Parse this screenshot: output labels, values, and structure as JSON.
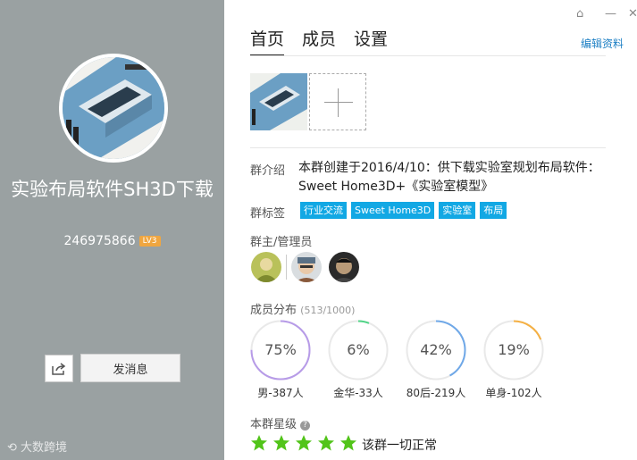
{
  "group": {
    "name": "实验布局软件SH3D下载",
    "id": "246975866",
    "level": "LV3"
  },
  "buttons": {
    "send_message": "发消息"
  },
  "watermark": "大数跨境",
  "window": {
    "controls": [
      "⌂",
      "—",
      "✕"
    ]
  },
  "tabs": [
    {
      "label": "首页",
      "active": true
    },
    {
      "label": "成员",
      "active": false
    },
    {
      "label": "设置",
      "active": false
    }
  ],
  "edit_link": "编辑资料",
  "intro": {
    "label": "群介绍",
    "text": "本群创建于2016/4/10：供下载实验室规划布局软件：  Sweet Home3D+《实验室模型》"
  },
  "tags": {
    "label": "群标签",
    "items": [
      "行业交流",
      "Sweet Home3D",
      "实验室",
      "布局"
    ]
  },
  "admins": {
    "label": "群主/管理员"
  },
  "distribution": {
    "label": "成员分布",
    "count": "(513/1000)",
    "stats": [
      {
        "percent": "75%",
        "value": 0.75,
        "caption": "男-387人",
        "color": "#b79be8"
      },
      {
        "percent": "6%",
        "value": 0.06,
        "caption": "金华-33人",
        "color": "#4fd486"
      },
      {
        "percent": "42%",
        "value": 0.42,
        "caption": "80后-219人",
        "color": "#6fa8e8"
      },
      {
        "percent": "19%",
        "value": 0.19,
        "caption": "单身-102人",
        "color": "#f5b043"
      }
    ]
  },
  "rating": {
    "label": "本群星级",
    "help": "?",
    "stars": 5,
    "status": "该群一切正常",
    "star_color": "#52c41a"
  }
}
